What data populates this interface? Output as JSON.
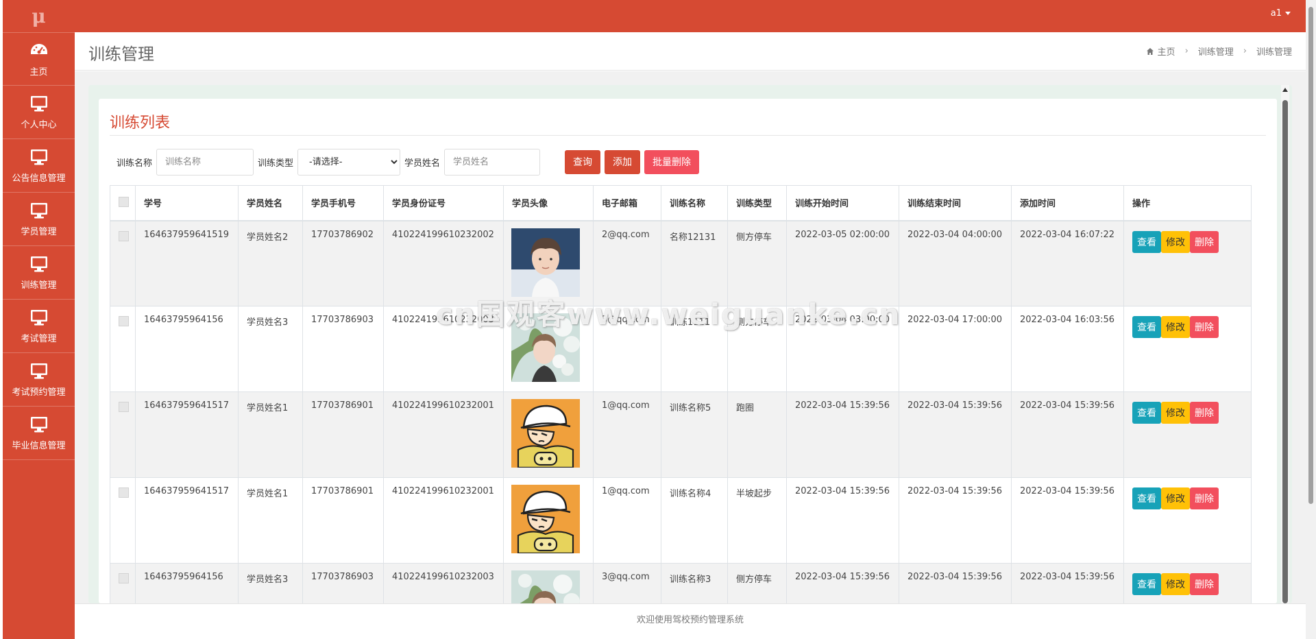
{
  "app": {
    "logo": "μ"
  },
  "topbar": {
    "user": "a1"
  },
  "sidebar": {
    "items": [
      {
        "label": "主页",
        "icon": "dashboard-icon"
      },
      {
        "label": "个人中心",
        "icon": "monitor-icon"
      },
      {
        "label": "公告信息管理",
        "icon": "monitor-icon"
      },
      {
        "label": "学员管理",
        "icon": "monitor-icon"
      },
      {
        "label": "训练管理",
        "icon": "monitor-icon"
      },
      {
        "label": "考试管理",
        "icon": "monitor-icon"
      },
      {
        "label": "考试预约管理",
        "icon": "monitor-icon"
      },
      {
        "label": "毕业信息管理",
        "icon": "monitor-icon"
      }
    ]
  },
  "header": {
    "title": "训练管理",
    "breadcrumb": [
      "主页",
      "训练管理",
      "训练管理"
    ]
  },
  "panel": {
    "title": "训练列表"
  },
  "filters": {
    "name_label": "训练名称",
    "name_placeholder": "训练名称",
    "type_label": "训练类型",
    "type_selected": "-请选择-",
    "student_label": "学员姓名",
    "student_placeholder": "学员姓名",
    "query_btn": "查询",
    "add_btn": "添加",
    "batch_delete_btn": "批量删除"
  },
  "table": {
    "columns": [
      "学号",
      "学员姓名",
      "学员手机号",
      "学员身份证号",
      "学员头像",
      "电子邮箱",
      "训练名称",
      "训练类型",
      "训练开始时间",
      "训练结束时间",
      "添加时间",
      "操作"
    ],
    "rows": [
      {
        "id": "164637959641519",
        "name": "学员姓名2",
        "phone": "17703786902",
        "idcard": "410224199610232002",
        "avatar": "photo-boy",
        "email": "2@qq.com",
        "train_name": "名称12131",
        "train_type": "侧方停车",
        "start": "2022-03-05 02:00:00",
        "end": "2022-03-04 04:00:00",
        "added": "2022-03-04 16:07:22"
      },
      {
        "id": "16463795964156",
        "name": "学员姓名3",
        "phone": "17703786903",
        "idcard": "410224199610232003",
        "avatar": "photo-flowers",
        "email": "3@qq.com",
        "train_name": "训练1111",
        "train_type": "侧方停车",
        "start": "2022-03-04 03:00:00",
        "end": "2022-03-04 17:00:00",
        "added": "2022-03-04 16:03:56"
      },
      {
        "id": "164637959641517",
        "name": "学员姓名1",
        "phone": "17703786901",
        "idcard": "410224199610232001",
        "avatar": "cartoon-boy",
        "email": "1@qq.com",
        "train_name": "训练名称5",
        "train_type": "跑圈",
        "start": "2022-03-04 15:39:56",
        "end": "2022-03-04 15:39:56",
        "added": "2022-03-04 15:39:56"
      },
      {
        "id": "164637959641517",
        "name": "学员姓名1",
        "phone": "17703786901",
        "idcard": "410224199610232001",
        "avatar": "cartoon-boy",
        "email": "1@qq.com",
        "train_name": "训练名称4",
        "train_type": "半坡起步",
        "start": "2022-03-04 15:39:56",
        "end": "2022-03-04 15:39:56",
        "added": "2022-03-04 15:39:56"
      },
      {
        "id": "16463795964156",
        "name": "学员姓名3",
        "phone": "17703786903",
        "idcard": "410224199610232003",
        "avatar": "photo-flowers",
        "email": "3@qq.com",
        "train_name": "训练名称3",
        "train_type": "侧方停车",
        "start": "2022-03-04 15:39:56",
        "end": "2022-03-04 15:39:56",
        "added": "2022-03-04 15:39:56"
      }
    ],
    "actions": {
      "view": "查看",
      "edit": "修改",
      "delete": "删除"
    }
  },
  "footer": {
    "text": "欢迎使用驾校预约管理系统"
  },
  "watermark": {
    "text": "cn国观客www.weiguanke.cn"
  },
  "colors": {
    "primary": "#d64a33",
    "info": "#17a2b8",
    "warning": "#ffc107",
    "danger": "#f24f5d"
  }
}
